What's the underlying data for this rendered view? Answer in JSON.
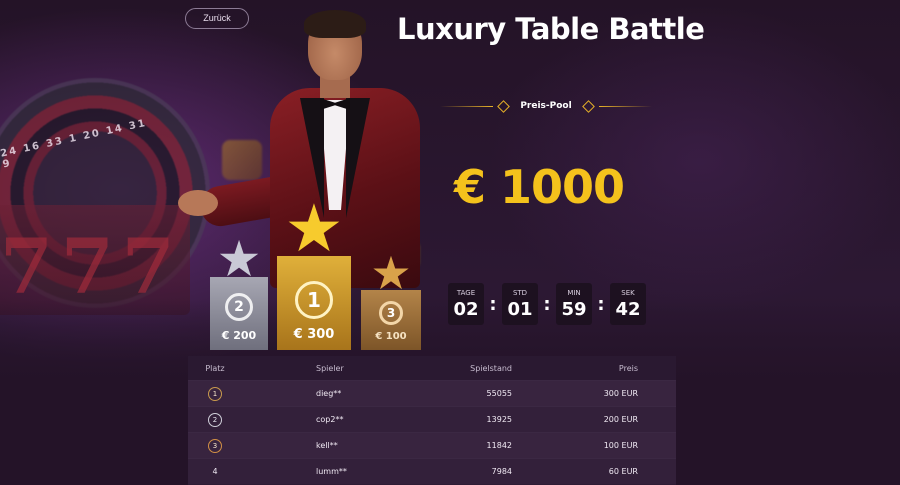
{
  "back_label": "Zurück",
  "title": "Luxury Table Battle",
  "decor": {
    "roulette_numbers": "24 16 33 1 20 14 31 9",
    "slot_sevens": "777"
  },
  "podium": [
    {
      "place": "2",
      "prize": "€ 200",
      "medal": "silver"
    },
    {
      "place": "1",
      "prize": "€ 300",
      "medal": "gold"
    },
    {
      "place": "3",
      "prize": "€ 100",
      "medal": "bronze"
    }
  ],
  "prize_pool": {
    "label": "Preis-Pool",
    "amount": "€ 1000"
  },
  "countdown": [
    {
      "label": "TAGE",
      "value": "02"
    },
    {
      "label": "STD",
      "value": "01"
    },
    {
      "label": "MIN",
      "value": "59"
    },
    {
      "label": "SEK",
      "value": "42"
    }
  ],
  "leaderboard": {
    "columns": {
      "place": "Platz",
      "player": "Spieler",
      "score": "Spielstand",
      "prize": "Preis"
    },
    "rows": [
      {
        "place": "1",
        "player": "dieg**",
        "score": "55055",
        "prize": "300 EUR",
        "medal": "gold"
      },
      {
        "place": "2",
        "player": "cop2**",
        "score": "13925",
        "prize": "200 EUR",
        "medal": "silver"
      },
      {
        "place": "3",
        "player": "kell**",
        "score": "11842",
        "prize": "100 EUR",
        "medal": "bronze"
      },
      {
        "place": "4",
        "player": "lumm**",
        "score": "7984",
        "prize": "60 EUR",
        "medal": ""
      }
    ]
  },
  "colors": {
    "background": "#241328",
    "accent_gold": "#f4c21c",
    "table_bg": "#2e1c35"
  }
}
